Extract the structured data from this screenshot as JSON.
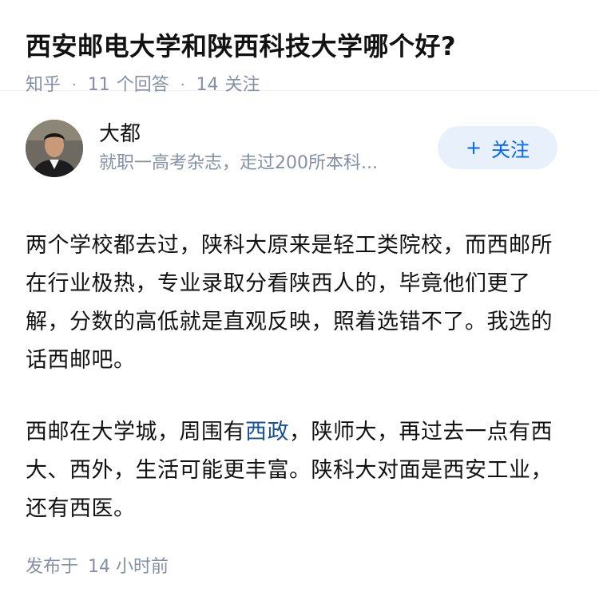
{
  "question": {
    "title": "西安邮电大学和陕西科技大学哪个好?",
    "source": "知乎",
    "answer_count": "11",
    "answer_label": "个回答",
    "follower_count": "14",
    "follower_label": "关注"
  },
  "author": {
    "name": "大都",
    "description": "就职一高考杂志，走过200所本科...",
    "follow_label": "关注"
  },
  "answer": {
    "para1": "两个学校都去过，陕科大原来是轻工类院校，而西邮所在行业极热，专业录取分看陕西人的，毕竟他们更了解，分数的高低就是直观反映，照着选错不了。我选的话西邮吧。",
    "para2_before": "西邮在大学城，周围有",
    "para2_link": "西政",
    "para2_after": "，陕师大，再过去一点有西大、西外，生活可能更丰富。陕科大对面是西安工业，还有西医。"
  },
  "footer": {
    "published_label": "发布于",
    "published_time": "14 小时前"
  },
  "colors": {
    "accent": "#0066ff",
    "link": "#175199",
    "meta": "#8590a6",
    "follow_bg": "#e8f0fb"
  }
}
